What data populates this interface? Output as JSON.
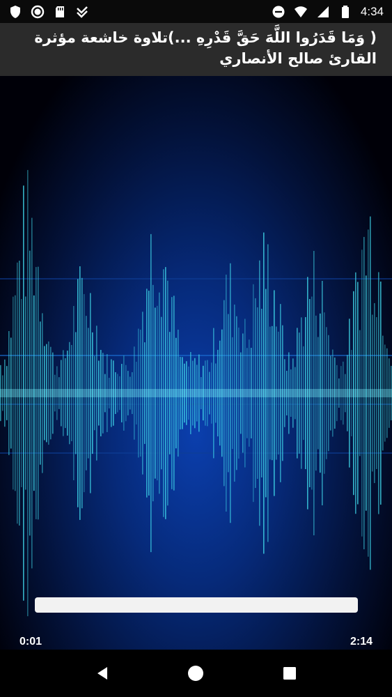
{
  "status_bar": {
    "time": "4:34",
    "icons_left": [
      "shield-icon",
      "record-icon",
      "sd-card-icon",
      "download-done-icon"
    ],
    "icons_right": [
      "do-not-disturb-icon",
      "wifi-icon",
      "signal-icon",
      "battery-icon"
    ]
  },
  "title": {
    "text": "( وَمَا قَدَرُوا اللَّهَ حَقَّ قَدْرِهِ ...)تلاوة خاشعة مؤثرة القارئ صالح الأنصاري"
  },
  "player": {
    "elapsed": "0:01",
    "duration": "2:14",
    "progress": 0.007,
    "stop_icon": "stop-icon",
    "equalizer_icon": "equalizer-icon"
  },
  "nav": {
    "back_icon": "back-triangle-icon",
    "home_icon": "home-circle-icon",
    "recents_icon": "recents-square-icon"
  },
  "colors": {
    "title_bar": "#2b2b2b",
    "background_blue": "#0b3fae",
    "wave_cyan": "#3fd6e8",
    "button_blue": "#2d9bea"
  }
}
